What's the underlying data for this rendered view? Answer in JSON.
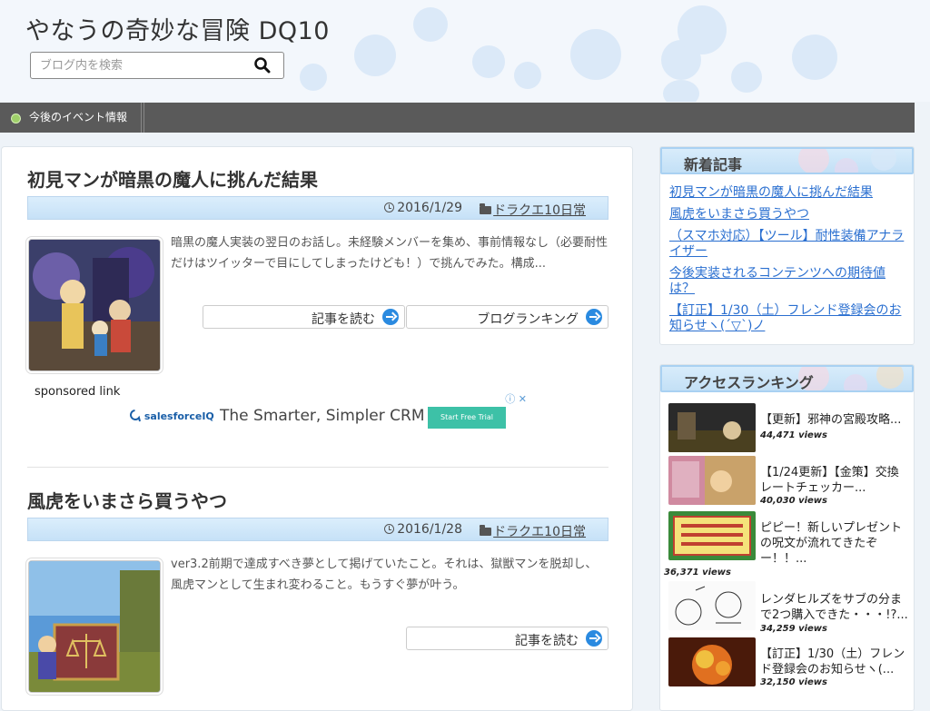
{
  "site": {
    "title": "やなうの奇妙な冒険 DQ10"
  },
  "search": {
    "placeholder": "ブログ内を検索"
  },
  "nav": {
    "items": [
      {
        "label": "今後のイベント情報"
      }
    ]
  },
  "posts": [
    {
      "title": "初見マンが暗黒の魔人に挑んだ結果",
      "date": "2016/1/29",
      "category": "ドラクエ10日常",
      "excerpt": "暗黒の魔人実装の翌日のお話し。未経験メンバーを集め、事前情報なし（必要耐性だけはツイッターで目にしてしまったけども！）で挑んでみた。構成...",
      "read_more": "記事を読む",
      "ranking": "ブログランキング"
    },
    {
      "title": "風虎をいまさら買うやつ",
      "date": "2016/1/28",
      "category": "ドラクエ10日常",
      "excerpt": "ver3.2前期で達成すべき夢として掲げていたこと。それは、獄獣マンを脱却し、風虎マンとして生まれ変わること。もうすぐ夢が叶う。",
      "read_more": "記事を読む"
    }
  ],
  "sponsored": {
    "label": "sponsored link",
    "ad_brand": "salesforceIQ",
    "ad_text": "The Smarter, Simpler CRM",
    "ad_button": "Start Free Trial",
    "ad_close": "ⓘ ✕"
  },
  "sidebar": {
    "new_posts": {
      "title": "新着記事",
      "items": [
        "初見マンが暗黒の魔人に挑んだ結果",
        "風虎をいまさら買うやつ",
        "（スマホ対応）【ツール】耐性装備アナライザー",
        "今後実装されるコンテンツへの期待値は？",
        "【訂正】1/30（土）フレンド登録会のお知らせヽ(´▽`)ノ"
      ]
    },
    "ranking": {
      "title": "アクセスランキング",
      "items": [
        {
          "title": "【更新】邪神の宮殿攻略...",
          "views": "44,471 views"
        },
        {
          "title": "【1/24更新】【金策】交換レートチェッカー...",
          "views": "40,030 views"
        },
        {
          "title": "ピピー！新しいプレゼントの呪文が流れてきたぞー！！...",
          "views": "36,371 views"
        },
        {
          "title": "レンダヒルズをサブの分まで2つ購入できた・・・!?...",
          "views": "34,259 views"
        },
        {
          "title": "【訂正】1/30（土）フレンド登録会のお知らせヽ(...",
          "views": "32,150 views"
        }
      ]
    }
  }
}
